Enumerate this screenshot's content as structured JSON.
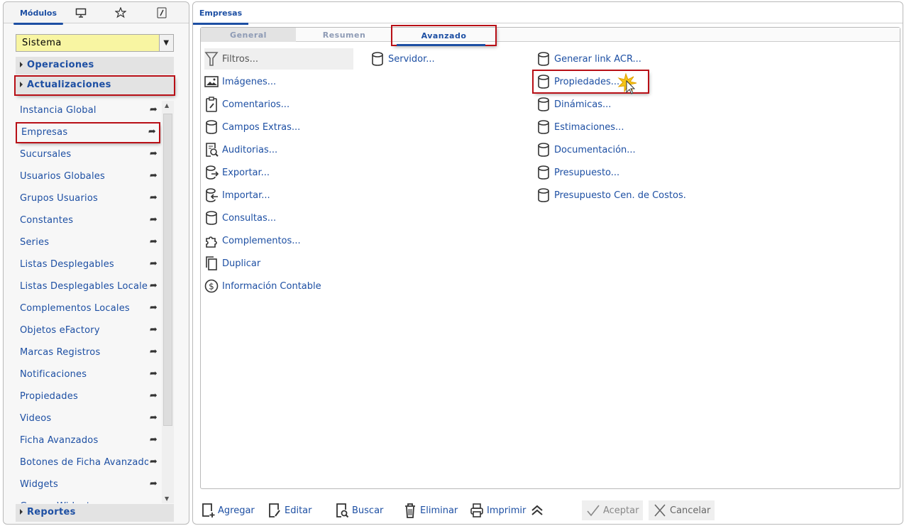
{
  "left": {
    "tabs": [
      {
        "label": "Módulos",
        "icon": null
      },
      {
        "label": "",
        "icon": "monitor-icon"
      },
      {
        "label": "",
        "icon": "star-icon"
      },
      {
        "label": "",
        "icon": "wrench-icon"
      }
    ],
    "module_select": "Sistema",
    "sections": {
      "operaciones": "Operaciones",
      "actualizaciones": "Actualizaciones",
      "reportes": "Reportes"
    },
    "items": [
      "Instancia Global",
      "Empresas",
      "Sucursales",
      "Usuarios Globales",
      "Grupos Usuarios",
      "Constantes",
      "Series",
      "Listas Desplegables",
      "Listas Desplegables Locales",
      "Complementos Locales",
      "Objetos eFactory",
      "Marcas Registros",
      "Notificaciones",
      "Propiedades",
      "Videos",
      "Ficha Avanzados",
      "Botones de Ficha Avanzados",
      "Widgets",
      "Grupos Widgets"
    ]
  },
  "right": {
    "tab": "Empresas",
    "inner_tabs": [
      "General",
      "Resumen",
      "Avanzado"
    ],
    "col1": [
      {
        "label": "Filtros...",
        "icon": "filter-icon"
      },
      {
        "label": "Imágenes...",
        "icon": "image-icon"
      },
      {
        "label": "Comentarios...",
        "icon": "clipboard-edit-icon"
      },
      {
        "label": "Campos Extras...",
        "icon": "database-icon"
      },
      {
        "label": "Auditorias...",
        "icon": "audit-search-icon"
      },
      {
        "label": "Exportar...",
        "icon": "export-icon"
      },
      {
        "label": "Importar...",
        "icon": "import-icon"
      },
      {
        "label": "Consultas...",
        "icon": "database-icon"
      },
      {
        "label": "Complementos...",
        "icon": "puzzle-icon"
      },
      {
        "label": "Duplicar",
        "icon": "copy-icon"
      },
      {
        "label": "Información Contable",
        "icon": "dollar-icon"
      }
    ],
    "col2": [
      {
        "label": "Servidor...",
        "icon": "database-icon"
      }
    ],
    "col3": [
      {
        "label": "Generar link ACR...",
        "icon": "database-icon"
      },
      {
        "label": "Propiedades...",
        "icon": "database-icon"
      },
      {
        "label": "Dinámicas...",
        "icon": "database-icon"
      },
      {
        "label": "Estimaciones...",
        "icon": "database-icon"
      },
      {
        "label": "Documentación...",
        "icon": "database-icon"
      },
      {
        "label": "Presupuesto...",
        "icon": "database-icon"
      },
      {
        "label": "Presupuesto Cen. de Costos.",
        "icon": "database-icon"
      }
    ],
    "footer": {
      "agregar": "Agregar",
      "editar": "Editar",
      "buscar": "Buscar",
      "eliminar": "Eliminar",
      "imprimir": "Imprimir",
      "aceptar": "Aceptar",
      "cancelar": "Cancelar"
    }
  },
  "colors": {
    "link": "#1d4fa3",
    "highlight": "#b80f16",
    "select_bg": "#f8f5a2"
  }
}
